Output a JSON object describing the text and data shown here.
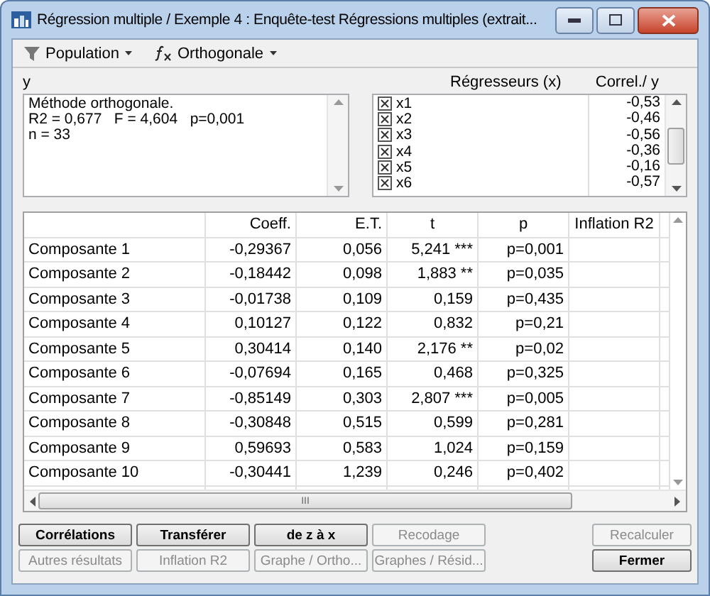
{
  "window": {
    "title": "Régression multiple / Exemple 4 : Enquête-test Régressions multiples (extrait..."
  },
  "toolbar": [
    {
      "kind": "filter",
      "label": "Population"
    },
    {
      "kind": "function",
      "label": "Orthogonale"
    }
  ],
  "y_panel": {
    "label": "y",
    "lines": [
      "Méthode orthogonale.",
      "R2 = 0,677   F = 4,604   p=0,001",
      "n = 33"
    ]
  },
  "regressors": {
    "label": "Régresseurs (x)",
    "corr_label": "Correl./ y",
    "items": [
      {
        "name": "x1",
        "checked": true,
        "corr": "-0,53"
      },
      {
        "name": "x2",
        "checked": true,
        "corr": "-0,46"
      },
      {
        "name": "x3",
        "checked": true,
        "corr": "-0,56"
      },
      {
        "name": "x4",
        "checked": true,
        "corr": "-0,36"
      },
      {
        "name": "x5",
        "checked": true,
        "corr": "-0,16"
      },
      {
        "name": "x6",
        "checked": true,
        "corr": "-0,57"
      }
    ]
  },
  "table": {
    "columns": [
      "",
      "Coeff.",
      "E.T.",
      "t",
      "p",
      "Inflation R2"
    ],
    "rows": [
      [
        "Composante  1",
        "-0,29367",
        "0,056",
        "5,241 ***",
        "p=0,001"
      ],
      [
        "Composante  2",
        "-0,18442",
        "0,098",
        "1,883 **",
        "p=0,035"
      ],
      [
        "Composante  3",
        "-0,01738",
        "0,109",
        "0,159",
        "p=0,435"
      ],
      [
        "Composante  4",
        "0,10127",
        "0,122",
        "0,832",
        "p=0,21"
      ],
      [
        "Composante  5",
        "0,30414",
        "0,140",
        "2,176 **",
        "p=0,02"
      ],
      [
        "Composante  6",
        "-0,07694",
        "0,165",
        "0,468",
        "p=0,325"
      ],
      [
        "Composante  7",
        "-0,85149",
        "0,303",
        "2,807 ***",
        "p=0,005"
      ],
      [
        "Composante  8",
        "-0,30848",
        "0,515",
        "0,599",
        "p=0,281"
      ],
      [
        "Composante  9",
        "0,59693",
        "0,583",
        "1,024",
        "p=0,159"
      ],
      [
        "Composante  10",
        "-0,30441",
        "1,239",
        "0,246",
        "p=0,402"
      ]
    ]
  },
  "buttons_row1": [
    {
      "label": "Corrélations",
      "disabled": false
    },
    {
      "label": "Transférer",
      "disabled": false
    },
    {
      "label": "de z à x",
      "disabled": false
    },
    {
      "label": "Recodage",
      "disabled": true
    }
  ],
  "buttons_row2": [
    {
      "label": "Autres résultats",
      "disabled": true
    },
    {
      "label": "Inflation R2",
      "disabled": true
    },
    {
      "label": "Graphe / Ortho...",
      "disabled": true
    },
    {
      "label": "Graphes / Résid...",
      "disabled": true
    }
  ],
  "side_buttons": [
    {
      "label": "Recalculer",
      "disabled": true
    },
    {
      "label": "Fermer",
      "disabled": false
    }
  ],
  "scroll_grip": "III"
}
